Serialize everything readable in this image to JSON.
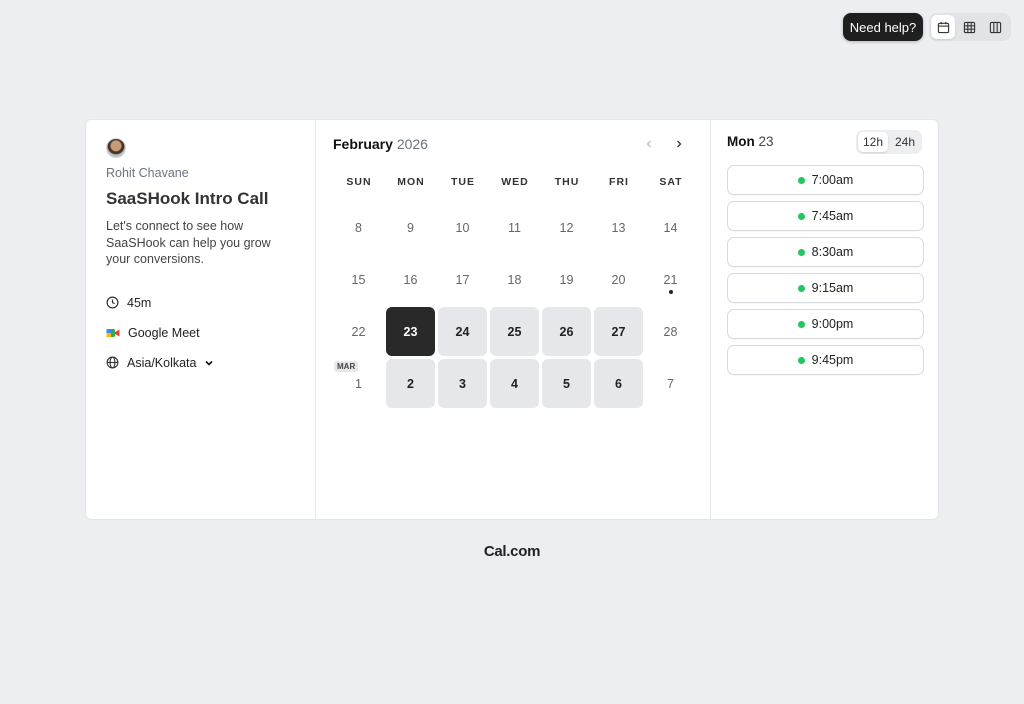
{
  "top_controls": {
    "help_label": "Need help?",
    "views": [
      "month-view-icon",
      "week-view-icon",
      "column-view-icon"
    ]
  },
  "event": {
    "host": "Rohit Chavane",
    "title": "SaaSHook Intro Call",
    "description": "Let's connect to see how SaaSHook can help you grow your conversions.",
    "duration": "45m",
    "location": "Google Meet",
    "timezone": "Asia/Kolkata"
  },
  "calendar": {
    "month": "February",
    "year": "2026",
    "weekdays": [
      "SUN",
      "MON",
      "TUE",
      "WED",
      "THU",
      "FRI",
      "SAT"
    ],
    "days": [
      {
        "n": "8",
        "s": "plain"
      },
      {
        "n": "9",
        "s": "plain"
      },
      {
        "n": "10",
        "s": "plain"
      },
      {
        "n": "11",
        "s": "plain"
      },
      {
        "n": "12",
        "s": "plain"
      },
      {
        "n": "13",
        "s": "plain"
      },
      {
        "n": "14",
        "s": "plain"
      },
      {
        "n": "15",
        "s": "plain"
      },
      {
        "n": "16",
        "s": "plain"
      },
      {
        "n": "17",
        "s": "plain"
      },
      {
        "n": "18",
        "s": "plain"
      },
      {
        "n": "19",
        "s": "plain"
      },
      {
        "n": "20",
        "s": "plain"
      },
      {
        "n": "21",
        "s": "today"
      },
      {
        "n": "22",
        "s": "plain"
      },
      {
        "n": "23",
        "s": "selected"
      },
      {
        "n": "24",
        "s": "avail"
      },
      {
        "n": "25",
        "s": "avail"
      },
      {
        "n": "26",
        "s": "avail"
      },
      {
        "n": "27",
        "s": "avail"
      },
      {
        "n": "28",
        "s": "plain"
      },
      {
        "n": "1",
        "s": "plain",
        "tag": "MAR"
      },
      {
        "n": "2",
        "s": "avail"
      },
      {
        "n": "3",
        "s": "avail"
      },
      {
        "n": "4",
        "s": "avail"
      },
      {
        "n": "5",
        "s": "avail"
      },
      {
        "n": "6",
        "s": "avail"
      },
      {
        "n": "7",
        "s": "plain"
      }
    ]
  },
  "slots_panel": {
    "day_name": "Mon",
    "day_num": "23",
    "format_12": "12h",
    "format_24": "24h",
    "times": [
      "7:00am",
      "7:45am",
      "8:30am",
      "9:15am",
      "9:00pm",
      "9:45pm"
    ]
  },
  "footer": {
    "brand": "Cal.com"
  },
  "colors": {
    "available_dot": "#22c55e",
    "selected_day": "#292929"
  }
}
